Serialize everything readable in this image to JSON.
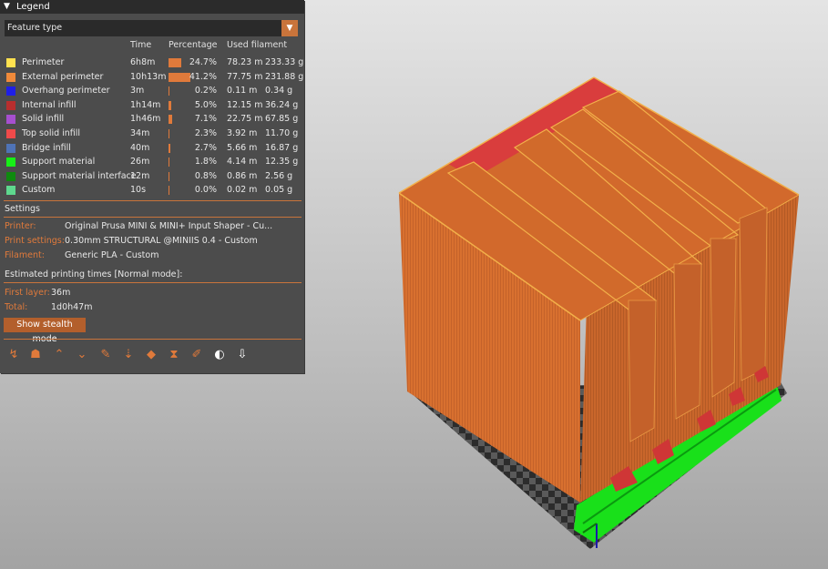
{
  "legend": {
    "title": "Legend",
    "view_type": "Feature type",
    "columns": {
      "time": "Time",
      "percentage": "Percentage",
      "used_filament": "Used filament"
    },
    "features": [
      {
        "name": "Perimeter",
        "color": "#ffe14f",
        "time": "6h8m",
        "pct": "24.7%",
        "pct_value": 24.7,
        "length": "78.23 m",
        "weight": "233.33 g"
      },
      {
        "name": "External perimeter",
        "color": "#f08a3a",
        "time": "10h13m",
        "pct": "41.2%",
        "pct_value": 41.2,
        "length": "77.75 m",
        "weight": "231.88 g"
      },
      {
        "name": "Overhang perimeter",
        "color": "#1f1fe6",
        "time": "3m",
        "pct": "0.2%",
        "pct_value": 0.2,
        "length": "0.11 m",
        "weight": "0.34 g"
      },
      {
        "name": "Internal infill",
        "color": "#b82e2e",
        "time": "1h14m",
        "pct": "5.0%",
        "pct_value": 5.0,
        "length": "12.15 m",
        "weight": "36.24 g"
      },
      {
        "name": "Solid infill",
        "color": "#a64fcf",
        "time": "1h46m",
        "pct": "7.1%",
        "pct_value": 7.1,
        "length": "22.75 m",
        "weight": "67.85 g"
      },
      {
        "name": "Top solid infill",
        "color": "#ef4a4a",
        "time": "34m",
        "pct": "2.3%",
        "pct_value": 2.3,
        "length": "3.92 m",
        "weight": "11.70 g"
      },
      {
        "name": "Bridge infill",
        "color": "#4f73b6",
        "time": "40m",
        "pct": "2.7%",
        "pct_value": 2.7,
        "length": "5.66 m",
        "weight": "16.87 g"
      },
      {
        "name": "Support material",
        "color": "#17ef17",
        "time": "26m",
        "pct": "1.8%",
        "pct_value": 1.8,
        "length": "4.14 m",
        "weight": "12.35 g"
      },
      {
        "name": "Support material interface",
        "color": "#0f8a0f",
        "time": "12m",
        "pct": "0.8%",
        "pct_value": 0.8,
        "length": "0.86 m",
        "weight": "2.56 g"
      },
      {
        "name": "Custom",
        "color": "#5ed88e",
        "time": "10s",
        "pct": "0.0%",
        "pct_value": 0.0,
        "length": "0.02 m",
        "weight": "0.05 g"
      }
    ],
    "settings": {
      "heading": "Settings",
      "printer_label": "Printer:",
      "printer_value": "Original Prusa MINI & MINI+ Input Shaper - Cu...",
      "print_label": "Print settings:",
      "print_value": "0.30mm STRUCTURAL @MINIIS 0.4 - Custom",
      "filament_label": "Filament:",
      "filament_value": "Generic PLA - Custom"
    },
    "estimates": {
      "heading": "Estimated printing times [Normal mode]:",
      "first_layer_label": "First layer:",
      "first_layer_value": "36m",
      "total_label": "Total:",
      "total_value": "1d0h47m"
    },
    "stealth_button": "Show stealth mode",
    "toolbar": [
      "travel-icon",
      "wipe-icon",
      "retractions-icon",
      "deretractions-icon",
      "seams-icon",
      "tool-changes-icon",
      "color-changes-icon",
      "pause-prints-icon",
      "custom-gcodes-icon",
      "center-of-gravity-icon",
      "tool-marker-icon"
    ]
  }
}
